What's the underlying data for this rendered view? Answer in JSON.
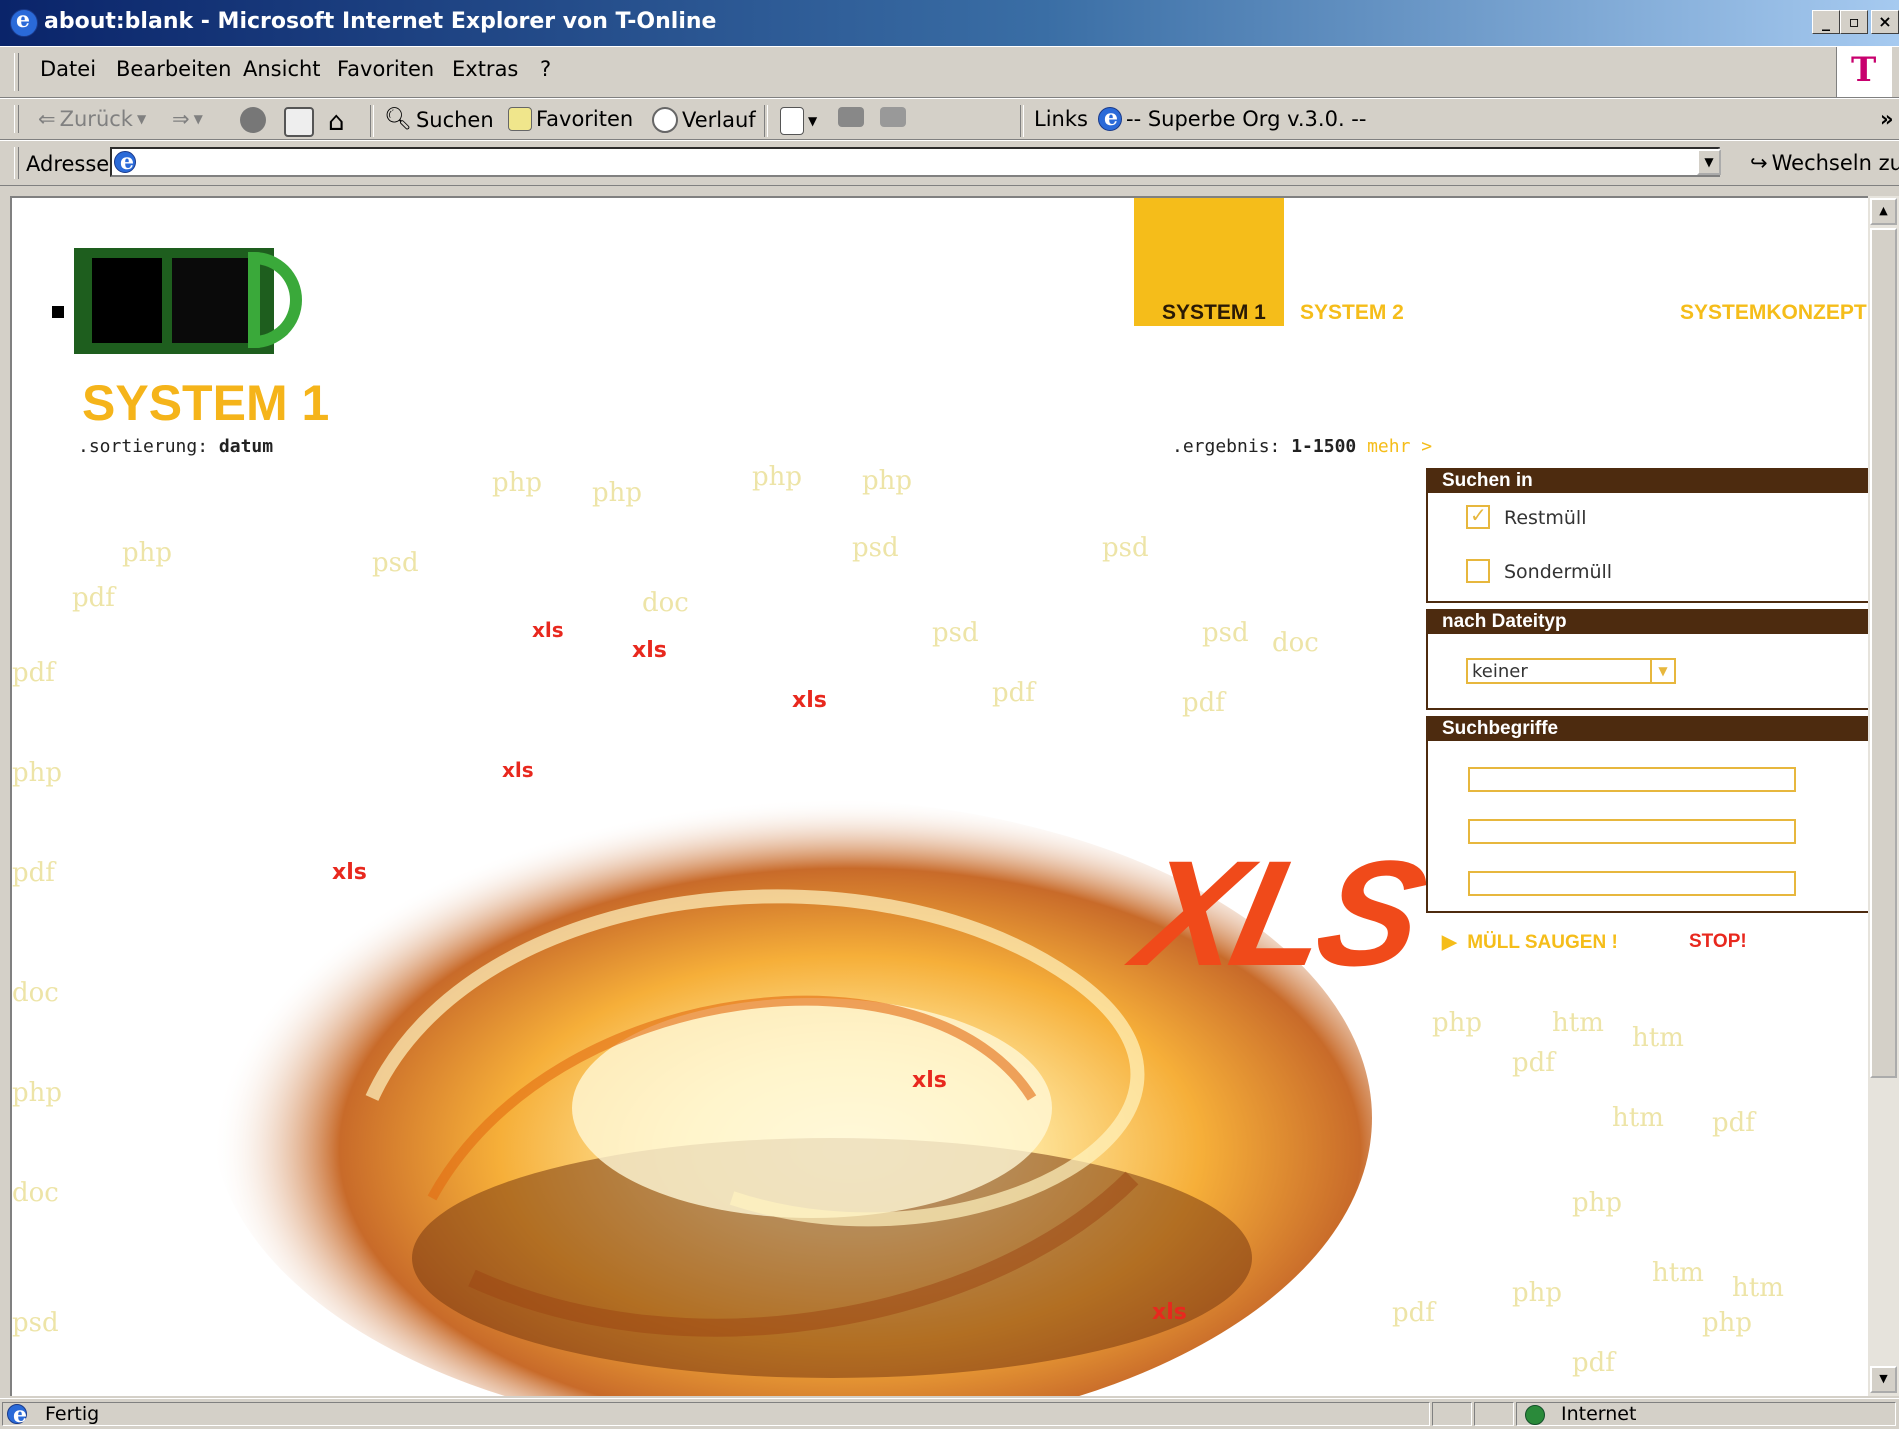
{
  "window": {
    "title": "about:blank - Microsoft Internet Explorer von T-Online",
    "controls": [
      "_",
      "▫",
      "×"
    ]
  },
  "menu": {
    "items": [
      "Datei",
      "Bearbeiten",
      "Ansicht",
      "Favoriten",
      "Extras",
      "?"
    ],
    "brand_logo": "T"
  },
  "toolbar": {
    "back": "Zurück",
    "search": "Suchen",
    "favorites": "Favoriten",
    "history": "Verlauf",
    "links_label": "Links",
    "link_item": "-- Superbe Org v.3.0. --",
    "overflow": "»"
  },
  "address": {
    "label": "Adresse",
    "value": "",
    "go": "Wechseln zu"
  },
  "page": {
    "nav": {
      "system1": "SYSTEM 1",
      "system2": "SYSTEM 2",
      "konzept": "SYSTEMKONZEPT"
    },
    "heading": "SYSTEM 1",
    "sort_prefix": ".sortierung:",
    "sort_value": "datum",
    "result_prefix": ".ergebnis:",
    "result_value": "1-1500",
    "more_link": "mehr >",
    "search_in": {
      "title": "Suchen in",
      "options": [
        {
          "label": "Restmüll",
          "checked": true
        },
        {
          "label": "Sondermüll",
          "checked": false
        }
      ]
    },
    "filetype": {
      "title": "nach Dateityp",
      "selected": "keiner"
    },
    "keywords": {
      "title": "Suchbegriffe",
      "fields": [
        "",
        "",
        ""
      ]
    },
    "submit": "MÜLL SAUGEN !",
    "stop": "STOP!",
    "artwork": {
      "big_label": "XLS",
      "background_words": [
        "php",
        "pdf",
        "psd",
        "doc",
        "xls",
        "htm"
      ]
    }
  },
  "status": {
    "text": "Fertig",
    "zone": "Internet"
  },
  "colors": {
    "accent": "#f5bd1a",
    "panel_header": "#4d2b0f",
    "stop": "#e8281e",
    "logo_green": "#2f8a2f"
  }
}
